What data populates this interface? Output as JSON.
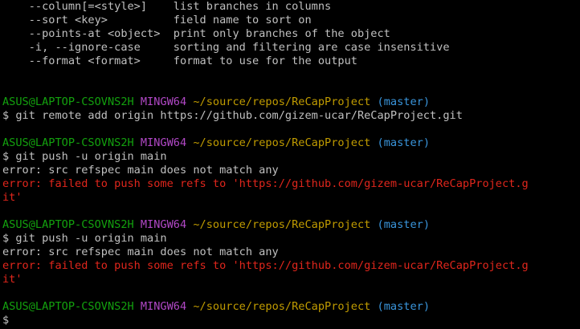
{
  "terminal": {
    "help_lines": [
      "    --column[=<style>]    list branches in columns",
      "    --sort <key>          field name to sort on",
      "    --points-at <object>  print only branches of the object",
      "    -i, --ignore-case     sorting and filtering are case insensitive",
      "    --format <format>     format to use for the output"
    ],
    "prompt": {
      "user_host": "ASUS@LAPTOP-CSOVNS2H",
      "system": "MINGW64",
      "path": "~/source/repos/ReCapProject",
      "branch": "(master)",
      "symbol": "$"
    },
    "blocks": [
      {
        "command": "$ git remote add origin https://github.com/gizem-ucar/ReCapProject.git",
        "output": [],
        "errors": []
      },
      {
        "command": "$ git push -u origin main",
        "output": [
          "error: src refspec main does not match any"
        ],
        "errors": [
          "error: failed to push some refs to 'https://github.com/gizem-ucar/ReCapProject.g",
          "it'"
        ]
      },
      {
        "command": "$ git push -u origin main",
        "output": [
          "error: src refspec main does not match any"
        ],
        "errors": [
          "error: failed to push some refs to 'https://github.com/gizem-ucar/ReCapProject.g",
          "it'"
        ]
      }
    ],
    "final_prompt_symbol": "$"
  },
  "colors": {
    "background": "#000000",
    "default_text": "#c0c0c0",
    "user_host": "#13a10e",
    "system": "#b148c6",
    "path": "#c19c00",
    "branch": "#3a96dd",
    "error": "#e0261c"
  }
}
